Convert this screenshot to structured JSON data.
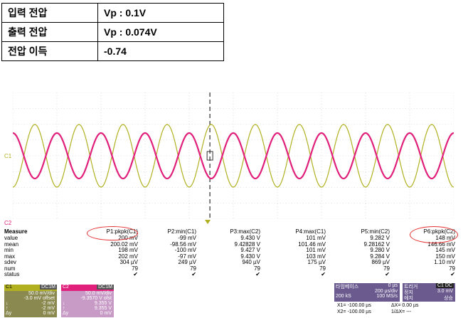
{
  "info_table": [
    {
      "label": "입력 전압",
      "value": "Vp : 0.1V"
    },
    {
      "label": "출력 전압",
      "value": "Vp : 0.074V"
    },
    {
      "label": "전압 이득",
      "value": "-0.74"
    }
  ],
  "scope": {
    "ch1_marker": "C1",
    "ch2_marker": "C2",
    "colors": {
      "ch1": "#b0b020",
      "ch2": "#e0207a",
      "grid": "#c8c8c8",
      "circle": "#e53030"
    },
    "measure": {
      "title": "Measure",
      "row_labels": [
        "value",
        "mean",
        "min",
        "max",
        "sdev",
        "num",
        "status"
      ],
      "columns": [
        {
          "header": "P1:pkpk(C1)",
          "cells": [
            "200 mV",
            "200.02 mV",
            "198 mV",
            "202 mV",
            "304 µV",
            "79",
            "✔"
          ]
        },
        {
          "header": "P2:min(C1)",
          "cells": [
            "-99 mV",
            "-98.56 mV",
            "-100 mV",
            "-97 mV",
            "249 µV",
            "79",
            "✔"
          ]
        },
        {
          "header": "P3:max(C2)",
          "cells": [
            "9.430 V",
            "9.42828 V",
            "9.427 V",
            "9.430 V",
            "940 µV",
            "79",
            "✔"
          ]
        },
        {
          "header": "P4:max(C1)",
          "cells": [
            "101 mV",
            "101.46 mV",
            "101 mV",
            "103 mV",
            "175 µV",
            "79",
            "✔"
          ]
        },
        {
          "header": "P5:min(C2)",
          "cells": [
            "9.282 V",
            "9.28162 V",
            "9.280 V",
            "9.284 V",
            "869 µV",
            "79",
            "✔"
          ]
        },
        {
          "header": "P6:pkpk(C2)",
          "cells": [
            "148 mV",
            "146.66 mV",
            "145 mV",
            "150 mV",
            "1.10 mV",
            "79",
            "✔"
          ]
        }
      ]
    },
    "ch1_panel": {
      "title": "C1",
      "coupling": "DC1M",
      "lines": [
        "50.0 mV/div",
        "-3.0 mV offset"
      ],
      "cursor_lines": [
        {
          "sym": "↓",
          "val": "-2 mV"
        },
        {
          "sym": "↑",
          "val": "-2 mV"
        },
        {
          "sym": "Δy",
          "val": "0 mV"
        }
      ]
    },
    "ch2_panel": {
      "title": "C2",
      "coupling": "DC1M",
      "lines": [
        "50.0 mV/div",
        "-9.3570 V ofst"
      ],
      "cursor_lines": [
        {
          "sym": "↓",
          "val": "9.355 V"
        },
        {
          "sym": "↑",
          "val": "9.355 V"
        },
        {
          "sym": "Δy",
          "val": "0 mV"
        }
      ]
    },
    "timebase": {
      "title": "타임베이스",
      "offset": "0 µs",
      "div": "200 µs/div",
      "samples": "200 kS",
      "rate": "100 MS/s"
    },
    "trigger": {
      "title": "트리거",
      "mode_badge": "C1 DC",
      "row1_label": "정지",
      "row1_value": "3.0 mV",
      "row2_label": "에지",
      "row2_value": "상승"
    },
    "cursor_readout": {
      "x1": "X1= -100.00 µs",
      "dx": "ΔX= 0.00 µs",
      "x2": "X2= -100.00 µs",
      "inv_dx": "1/ΔX= ---"
    }
  }
}
